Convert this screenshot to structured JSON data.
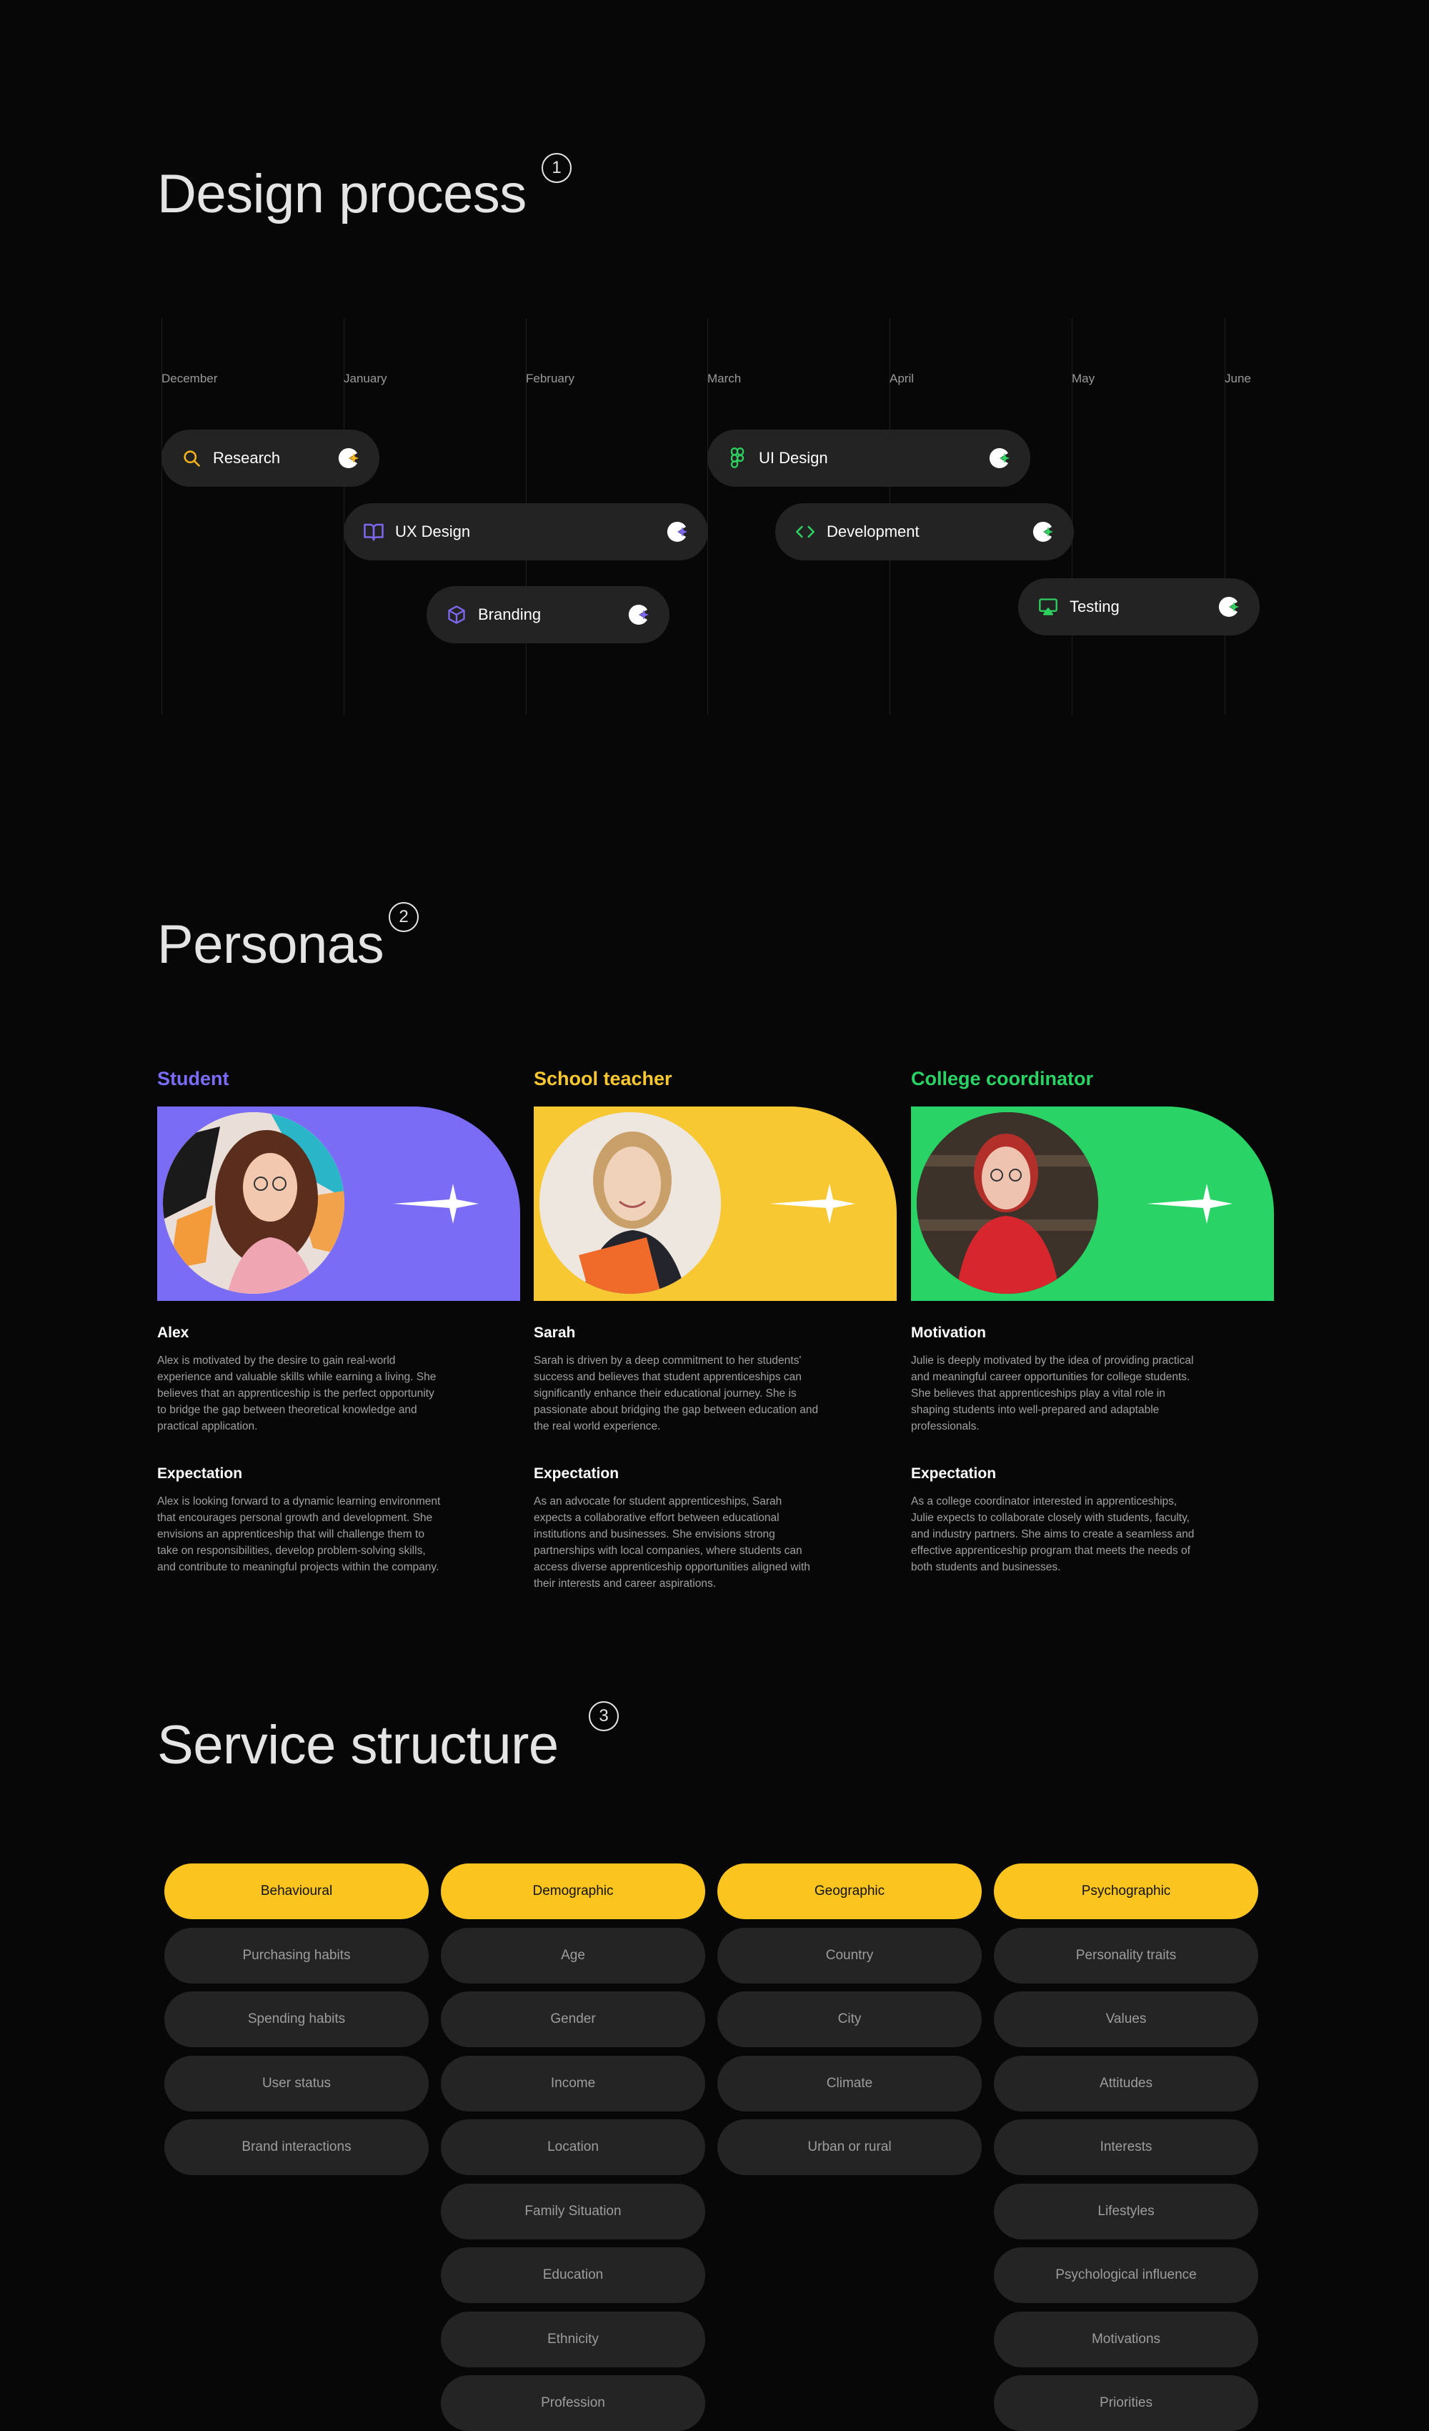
{
  "design_process": {
    "title": "Design process",
    "step": "1",
    "months": [
      "December",
      "January",
      "February",
      "March",
      "April",
      "May",
      "June"
    ],
    "tasks": [
      {
        "label": "Research",
        "icon": "search-icon",
        "color": "#f5b41e"
      },
      {
        "label": "UX Design",
        "icon": "book-open-icon",
        "color": "#7b68ee"
      },
      {
        "label": "Branding",
        "icon": "cube-icon",
        "color": "#7b68ee"
      },
      {
        "label": "UI Design",
        "icon": "figma-icon",
        "color": "#2ed160"
      },
      {
        "label": "Development",
        "icon": "code-icon",
        "color": "#2ed160"
      },
      {
        "label": "Testing",
        "icon": "monitor-icon",
        "color": "#2ed160"
      }
    ]
  },
  "personas": {
    "title": "Personas",
    "step": "2",
    "items": [
      {
        "role": "Student",
        "color": "#7b6cf6",
        "heading1": "Alex",
        "text1": "Alex is motivated by the desire to gain real-world experience and valuable skills while earning a living. She believes that an apprenticeship is the perfect opportunity to bridge the gap between theoretical knowledge and practical application.",
        "heading2": "Expectation",
        "text2": "Alex is looking forward to a dynamic learning environment that encourages personal growth and development.  She envisions an apprenticeship that will challenge them to take on responsibilities, develop problem-solving skills, and contribute to meaningful projects within the company."
      },
      {
        "role": "School teacher",
        "color": "#f8c832",
        "heading1": "Sarah",
        "text1": "Sarah is driven by a deep commitment to her students' success and believes that student apprenticeships can significantly enhance their educational journey. She is passionate about bridging the gap between education and the real world experience.",
        "heading2": "Expectation",
        "text2": "As an advocate for student apprenticeships, Sarah expects a collaborative effort between educational institutions and businesses. She envisions strong partnerships with local companies, where students can access diverse apprenticeship opportunities aligned with their interests and career aspirations."
      },
      {
        "role": "College coordinator",
        "color": "#2ad365",
        "heading1": "Motivation",
        "text1": "Julie is deeply motivated by the idea of providing practical and meaningful career opportunities for college students. She believes that apprenticeships play a vital role in shaping students into well-prepared and adaptable professionals.",
        "heading2": "Expectation",
        "text2": "As a college coordinator interested in apprenticeships, Julie expects to collaborate closely with students, faculty, and industry partners. She aims to create a seamless and effective apprenticeship program that meets the needs of both students and businesses."
      }
    ]
  },
  "service_structure": {
    "title": "Service structure",
    "step": "3",
    "columns": [
      {
        "header": "Behavioural",
        "items": [
          "Purchasing habits",
          "Spending habits",
          "User status",
          "Brand interactions"
        ]
      },
      {
        "header": "Demographic",
        "items": [
          "Age",
          "Gender",
          "Income",
          "Location",
          "Family Situation",
          "Education",
          "Ethnicity",
          "Profession"
        ]
      },
      {
        "header": "Geographic",
        "items": [
          "Country",
          "City",
          "Climate",
          "Urban or rural"
        ]
      },
      {
        "header": "Psychographic",
        "items": [
          "Personality traits",
          "Values",
          "Attitudes",
          "Interests",
          "Lifestyles",
          "Psychological influence",
          "Motivations",
          "Priorities"
        ]
      }
    ]
  }
}
